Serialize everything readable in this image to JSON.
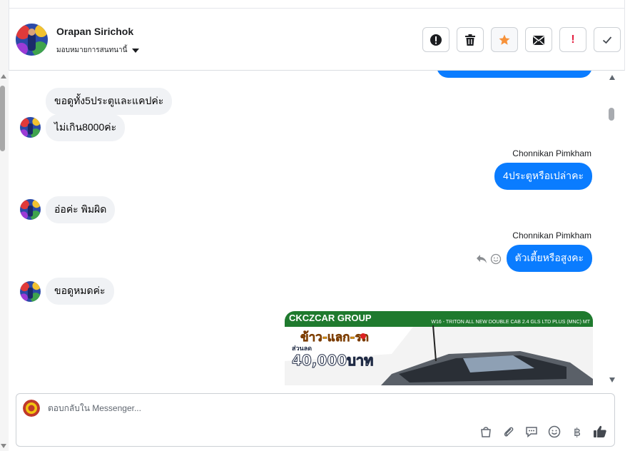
{
  "header": {
    "name": "Orapan Sirichok",
    "assign_label": "มอบหมายการสนทนานี้",
    "actions": [
      "report-icon",
      "trash-icon",
      "star-icon",
      "mark-unread-icon",
      "spam-icon",
      "done-icon"
    ],
    "spam_glyph": "!"
  },
  "messages": [
    {
      "side": "in",
      "text": "ขอดูทั้ง5ประตูและแคปค่ะ"
    },
    {
      "side": "in",
      "text": "ไม่เกิน8000ค่ะ"
    },
    {
      "side": "out",
      "sender": "Chonnikan Pimkham",
      "text": "4ประตูหรือเปล่าคะ"
    },
    {
      "side": "in",
      "text": "อ่อค่ะ พิมผิด"
    },
    {
      "side": "out",
      "sender": "Chonnikan Pimkham",
      "text": "ตัวเตี้ยหรือสูงคะ"
    },
    {
      "side": "in",
      "text": "ขอดูหมดค่ะ"
    }
  ],
  "ad": {
    "top_text": "CKCZCAR GROUP",
    "model": "W16 - TRITON ALL NEW DOUBLE CAB 2.4 GLS LTD PLUS (MNC) MT",
    "promo_title": "ข้าว-แลก-รถ",
    "discount_label": "ส่วนลด",
    "discount_value": "40,000บาท"
  },
  "composer": {
    "placeholder": "ตอบกลับใน Messenger...",
    "baht_symbol": "฿"
  },
  "colors": {
    "accent": "#0a7cff",
    "incoming_bubble": "#f0f2f5",
    "star": "#f7923a",
    "spam": "#e41e3f"
  }
}
